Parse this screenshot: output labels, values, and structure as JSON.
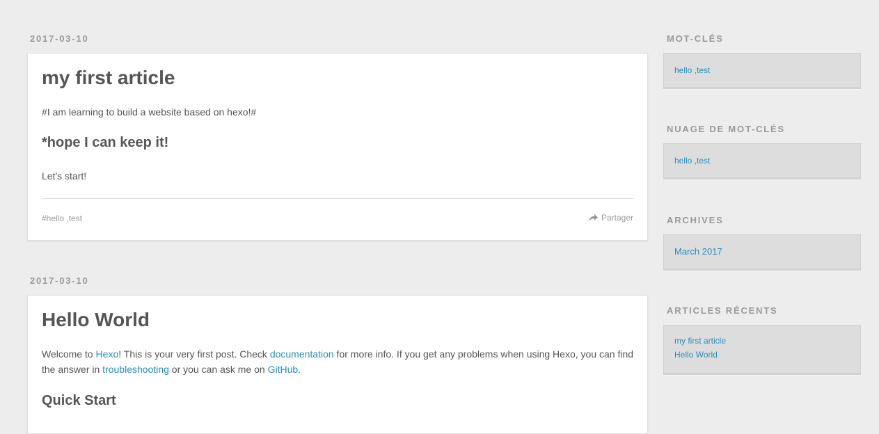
{
  "posts": [
    {
      "date": "2017-03-10",
      "title": "my first article",
      "p1": "#I am learning to build a website based on hexo!#",
      "h2": "*hope I can keep it!",
      "p2": "Let's start!",
      "tags": "#hello ,test",
      "share_label": "Partager"
    },
    {
      "date": "2017-03-10",
      "title": "Hello World",
      "welcome": {
        "t1": "Welcome to ",
        "l1": "Hexo",
        "t2": "! This is your very first post. Check ",
        "l2": "documentation",
        "t3": " for more info. If you get any problems when using Hexo, you can find the answer in ",
        "l3": "troubleshooting",
        "t4": " or you can ask me on ",
        "l4": "GitHub",
        "t5": "."
      },
      "h2": "Quick Start"
    }
  ],
  "sidebar": {
    "tags_title": "MOT-CLÉS",
    "tags_link": "hello ,test",
    "tagcloud_title": "NUAGE DE MOT-CLÉS",
    "tagcloud_link": "hello ,test",
    "archives_title": "ARCHIVES",
    "archives_link": "March 2017",
    "recent_title": "ARTICLES RÉCENTS",
    "recent": [
      "my first article",
      "Hello World"
    ]
  },
  "colors": {
    "link": "#258fb8",
    "background": "#ededed",
    "text": "#555555",
    "muted": "#999999"
  },
  "icons": {
    "share": "share-arrow-icon"
  }
}
